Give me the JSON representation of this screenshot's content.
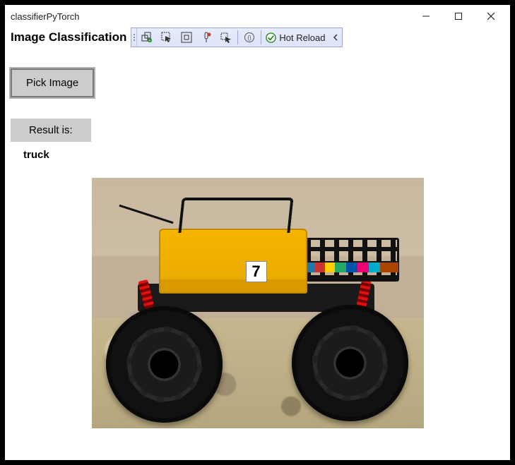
{
  "window": {
    "title": "classifierPyTorch"
  },
  "header": {
    "heading": "Image Classification"
  },
  "toolbar": {
    "hot_reload_label": "Hot Reload"
  },
  "controls": {
    "pick_image_label": "Pick Image",
    "result_label": "Result is:",
    "result_value": "truck"
  },
  "image_plate": "7"
}
